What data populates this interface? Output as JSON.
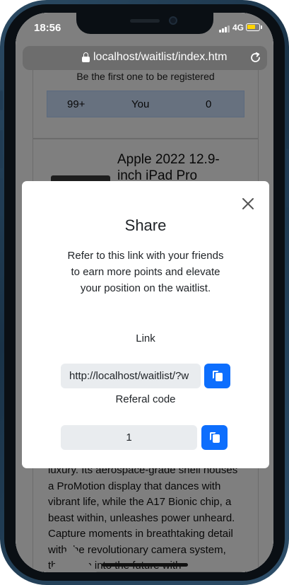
{
  "status_bar": {
    "time": "18:56",
    "network": "4G",
    "battery_level": 0.75,
    "battery_color": "#ffd400"
  },
  "browser": {
    "url": "localhost/waitlist/index.htm",
    "lock_icon": "lock-icon",
    "reload_icon": "reload-icon"
  },
  "page": {
    "leaderboard_caption": "Be the first one to be registered",
    "leaderboard_row": {
      "rank": "99+",
      "name": "You",
      "points": "0"
    },
    "product_title": "Apple 2022 12.9-inch iPad Pro",
    "product_description": "luxury. Its aerospace-grade shell houses a ProMotion display that dances with vibrant life, while the A17 Bionic chip, a beast within, unleashes power unheard. Capture moments in breathtaking detail with the revolutionary camera system, then step into the future with"
  },
  "modal": {
    "title": "Share",
    "description": "Refer to this link with your friends to earn more points and elevate your position on the waitlist.",
    "close_icon": "close-icon",
    "link_label": "Link",
    "link_value": "http://localhost/waitlist/?w",
    "code_label": "Referal code",
    "code_value": "1",
    "copy_icon": "copy-icon",
    "accent_color": "#0d6efd"
  }
}
